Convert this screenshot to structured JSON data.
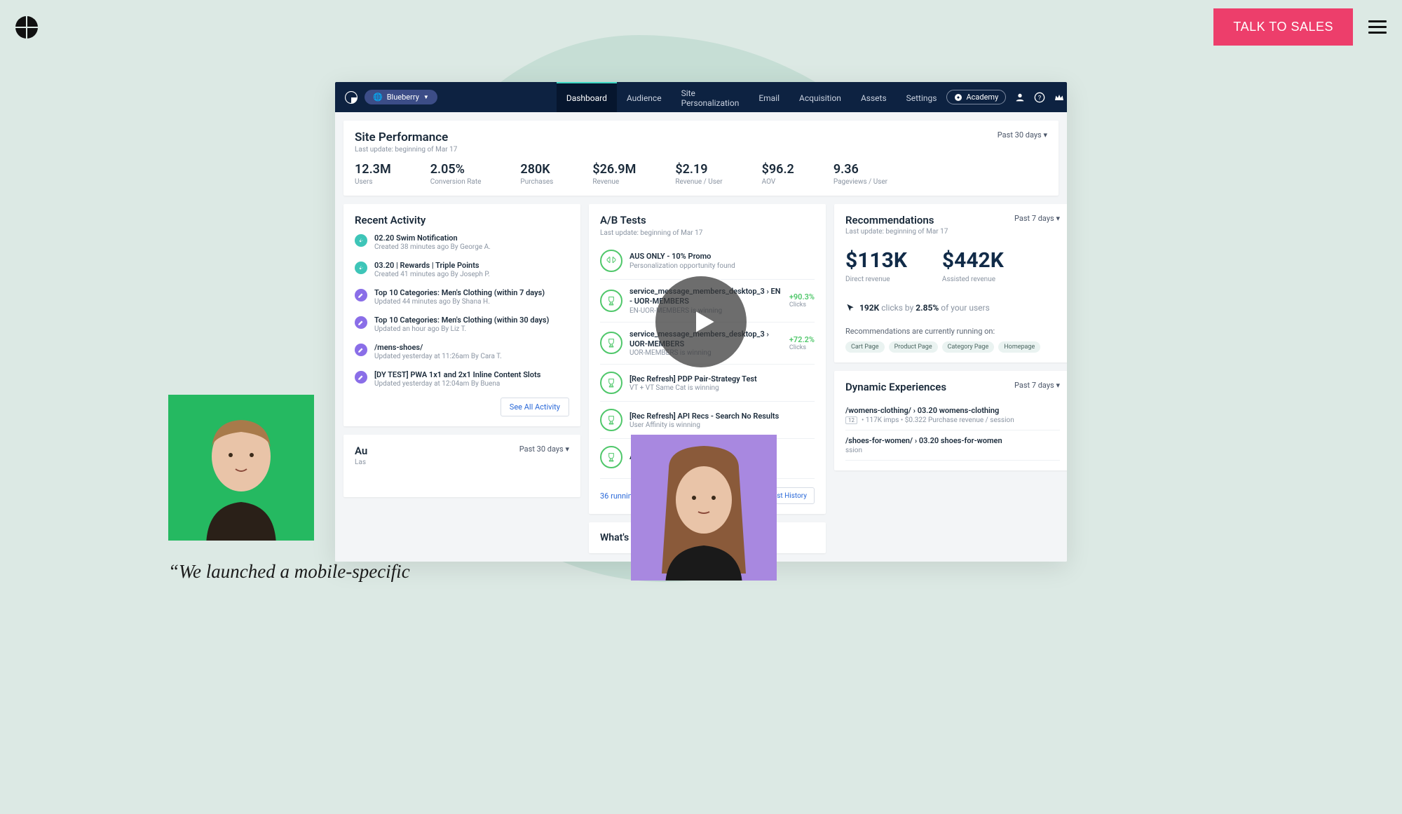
{
  "site_header": {
    "cta_label": "TALK TO SALES"
  },
  "app_nav": {
    "brand": "Blueberry",
    "tabs": [
      "Dashboard",
      "Audience",
      "Site Personalization",
      "Email",
      "Acquisition",
      "Assets",
      "Settings"
    ],
    "academy_label": "Academy"
  },
  "performance": {
    "title": "Site Performance",
    "subtitle": "Last update: beginning of Mar 17",
    "range": "Past 30 days",
    "metrics": [
      {
        "value": "12.3M",
        "label": "Users"
      },
      {
        "value": "2.05%",
        "label": "Conversion Rate"
      },
      {
        "value": "280K",
        "label": "Purchases"
      },
      {
        "value": "$26.9M",
        "label": "Revenue"
      },
      {
        "value": "$2.19",
        "label": "Revenue / User"
      },
      {
        "value": "$96.2",
        "label": "AOV"
      },
      {
        "value": "9.36",
        "label": "Pageviews / User"
      }
    ]
  },
  "activity": {
    "title": "Recent Activity",
    "see_all": "See All Activity",
    "items": [
      {
        "kind": "teal",
        "title": "02.20 Swim Notification",
        "sub": "Created 38 minutes ago By George A."
      },
      {
        "kind": "teal",
        "title": "03.20 | Rewards | Triple Points",
        "sub": "Created 41 minutes ago By Joseph P."
      },
      {
        "kind": "purple",
        "title": "Top 10 Categories: Men's Clothing (within 7 days)",
        "sub": "Updated 44 minutes ago By Shana H."
      },
      {
        "kind": "purple",
        "title": "Top 10 Categories: Men's Clothing (within 30 days)",
        "sub": "Updated an hour ago By Liz T."
      },
      {
        "kind": "purple",
        "title": "/mens-shoes/",
        "sub": "Updated yesterday at 11:26am By Cara T."
      },
      {
        "kind": "purple",
        "title": "[DY TEST] PWA 1x1 and 2x1 Inline Content Slots",
        "sub": "Updated yesterday at 12:04am By Buena"
      }
    ]
  },
  "audience": {
    "title": "Au",
    "subtitle": "Las",
    "range": "Past 30 days"
  },
  "abtests": {
    "title": "A/B Tests",
    "subtitle": "Last update: beginning of Mar 17",
    "running": "36 running tests",
    "history_label": "A/B Test History",
    "items": [
      {
        "icon": "brain",
        "title": "AUS ONLY - 10% Promo",
        "sub": "Personalization opportunity found",
        "stat": "",
        "stat_sub": ""
      },
      {
        "icon": "trophy",
        "title": "service_message_members_desktop_3 › EN - UOR-MEMBERS",
        "sub": "EN-UOR-MEMBERS is winning",
        "stat": "+90.3%",
        "stat_sub": "Clicks"
      },
      {
        "icon": "trophy",
        "title": "service_message_members_desktop_3 › UOR-MEMBERS",
        "sub": "UOR-MEMBERS is winning",
        "stat": "+72.2%",
        "stat_sub": "Clicks"
      },
      {
        "icon": "trophy",
        "title": "[Rec Refresh] PDP Pair-Strategy Test",
        "sub": "VT + VT Same Cat is winning",
        "stat": "",
        "stat_sub": ""
      },
      {
        "icon": "trophy",
        "title": "[Rec Refresh] API Recs - Search No Results",
        "sub": "User Affinity is winning",
        "stat": "",
        "stat_sub": ""
      },
      {
        "icon": "trophy",
        "title": "API Recs - Not Found",
        "sub": "",
        "stat": "",
        "stat_sub": ""
      }
    ]
  },
  "whats_new": {
    "title": "What's New in Dynamic Yield"
  },
  "recommendations": {
    "title": "Recommendations",
    "subtitle": "Last update: beginning of Mar 17",
    "range": "Past 7 days",
    "direct_value": "$113K",
    "direct_label": "Direct revenue",
    "assisted_value": "$442K",
    "assisted_label": "Assisted revenue",
    "clicks_count": "192K",
    "clicks_mid": " clicks by ",
    "clicks_pct": "2.85%",
    "clicks_suffix": " of your users",
    "running_label": "Recommendations are currently running on:",
    "chips": [
      "Cart Page",
      "Product Page",
      "Category Page",
      "Homepage"
    ]
  },
  "dynamic": {
    "title": "Dynamic Experiences",
    "range": "Past 7 days",
    "items": [
      {
        "title": "/womens-clothing/ › 03.20 womens-clothing",
        "badge": "12",
        "sub": "117K imps  •  $0.322 Purchase revenue / session"
      },
      {
        "title": "/shoes-for-women/ › 03.20 shoes-for-women",
        "badge": "",
        "sub": "ssion"
      }
    ]
  },
  "quote": {
    "text": "“We launched a mobile-specific"
  }
}
